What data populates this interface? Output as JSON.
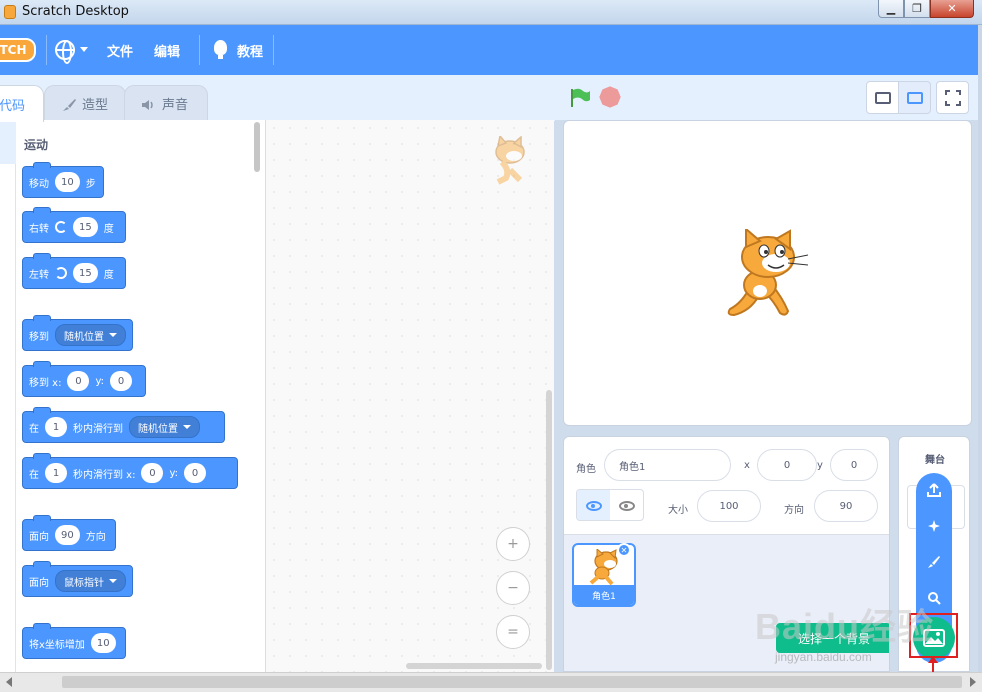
{
  "window": {
    "title": "Scratch Desktop",
    "controls": [
      "minimize-icon",
      "restore-icon",
      "close-icon"
    ]
  },
  "menubar": {
    "logo_text": "TCH",
    "items": [
      {
        "label": "文件"
      },
      {
        "label": "编辑"
      },
      {
        "label": "教程"
      }
    ]
  },
  "tabs": [
    {
      "label": "代码",
      "icon": "code-icon",
      "active": true
    },
    {
      "label": "造型",
      "icon": "brush-icon",
      "active": false
    },
    {
      "label": "声音",
      "icon": "speaker-icon",
      "active": false
    }
  ],
  "palette": {
    "category_title": "运动",
    "blocks": {
      "move": {
        "pre": "移动",
        "value": "10",
        "post": "步"
      },
      "turn_right": {
        "pre": "右转",
        "value": "15",
        "post": "度"
      },
      "turn_left": {
        "pre": "左转",
        "value": "15",
        "post": "度"
      },
      "goto": {
        "pre": "移到",
        "menu": "随机位置"
      },
      "goto_xy": {
        "pre": "移到 x:",
        "x": "0",
        "ylabel": "y:",
        "y": "0"
      },
      "glide": {
        "pre": "在",
        "secs": "1",
        "mid": "秒内滑行到",
        "menu": "随机位置"
      },
      "glide_xy": {
        "pre": "在",
        "secs": "1",
        "mid": "秒内滑行到 x:",
        "x": "0",
        "ylabel": "y:",
        "y": "0"
      },
      "point_dir": {
        "pre": "面向",
        "value": "90",
        "post": "方向"
      },
      "point_towards": {
        "pre": "面向",
        "menu": "鼠标指针"
      },
      "change_x": {
        "pre": "将x坐标增加",
        "value": "10"
      }
    }
  },
  "workspace": {
    "zoom_in": "+",
    "zoom_out": "−",
    "zoom_reset": "="
  },
  "sprite_info": {
    "sprite_label": "角色",
    "sprite_name": "角色1",
    "x_label": "x",
    "x_value": "0",
    "y_label": "y",
    "y_value": "0",
    "size_label": "大小",
    "size_value": "100",
    "direction_label": "方向",
    "direction_value": "90"
  },
  "sprites": [
    {
      "name": "角色1",
      "selected": true
    }
  ],
  "stage_pane": {
    "title": "舞台"
  },
  "tooltip": {
    "text": "选择一个背景"
  },
  "watermark": {
    "text": "Baidu经验",
    "url": "jingyan.baidu.com"
  },
  "colors": {
    "accent": "#4c97ff",
    "menubar": "#4c97ff",
    "backdrop_button": "#0fbd8c",
    "highlight": "#e02020",
    "cat_orange": "#f7a93b"
  }
}
